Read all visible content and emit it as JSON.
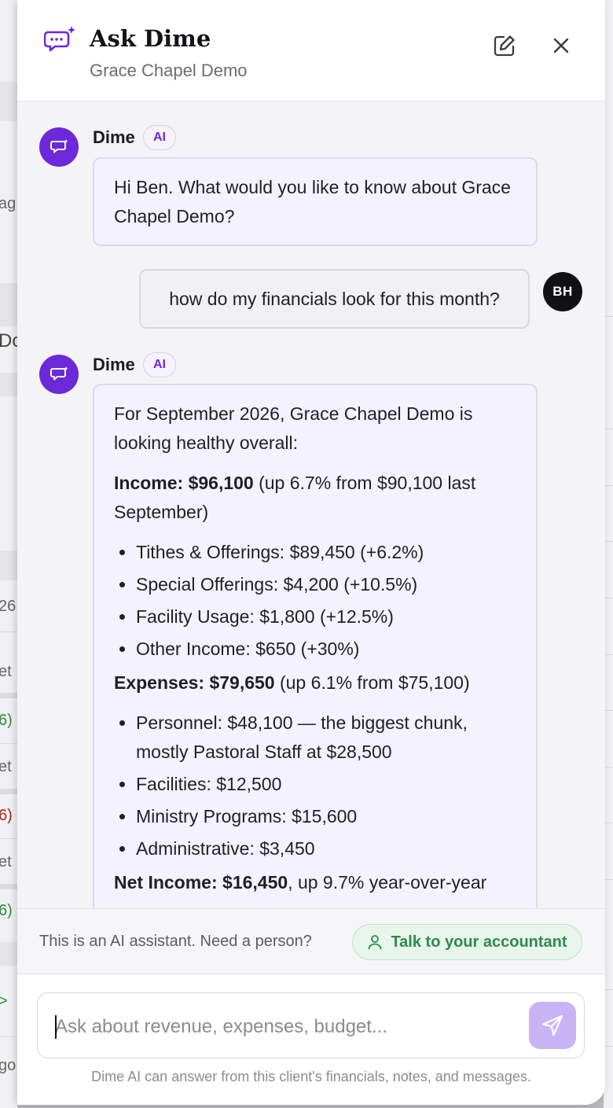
{
  "background": {
    "fragments": [
      "ag",
      "Do",
      "26",
      "et",
      "6)",
      "et",
      "6)",
      "et",
      "6)",
      ">",
      "go"
    ]
  },
  "header": {
    "title": "Ask Dime",
    "subtitle": "Grace Chapel Demo",
    "icons": {
      "logo": "chat-sparkle-icon",
      "edit": "edit-icon",
      "close": "close-icon"
    }
  },
  "messages": {
    "greeting": {
      "sender": "Dime",
      "badge": "AI",
      "text": "Hi Ben. What would you like to know about Grace Chapel Demo?"
    },
    "question": {
      "text": "how do my financials look for this month?",
      "avatar_initials": "BH"
    },
    "reply": {
      "sender": "Dime",
      "badge": "AI",
      "intro": "For September 2026, Grace Chapel Demo is looking healthy overall:",
      "income": {
        "label": "Income: $96,100",
        "detail": " (up 6.7% from $90,100 last September)",
        "items": [
          "Tithes & Offerings: $89,450 (+6.2%)",
          "Special Offerings: $4,200 (+10.5%)",
          "Facility Usage: $1,800 (+12.5%)",
          "Other Income: $650 (+30%)"
        ]
      },
      "expenses": {
        "label": "Expenses: $79,650",
        "detail": " (up 6.1% from $75,100)",
        "items": [
          "Personnel: $48,100 — the biggest chunk, mostly Pastoral Staff at $28,500",
          "Facilities: $12,500",
          "Ministry Programs: $15,600",
          "Administrative: $3,450"
        ]
      },
      "net": {
        "label": "Net Income: $16,450",
        "detail": ", up 9.7% year-over-year"
      }
    }
  },
  "footer": {
    "note": "This is an AI assistant. Need a person?",
    "accountant_button": "Talk to your accountant"
  },
  "composer": {
    "placeholder": "Ask about revenue, expenses, budget...",
    "disclaimer": "Dime AI can answer from this client's financials, notes, and messages.",
    "accent_color": "#c8b4f5"
  },
  "colors": {
    "brand_purple": "#6d28d9",
    "accountant_green": "#2e8a4c"
  }
}
